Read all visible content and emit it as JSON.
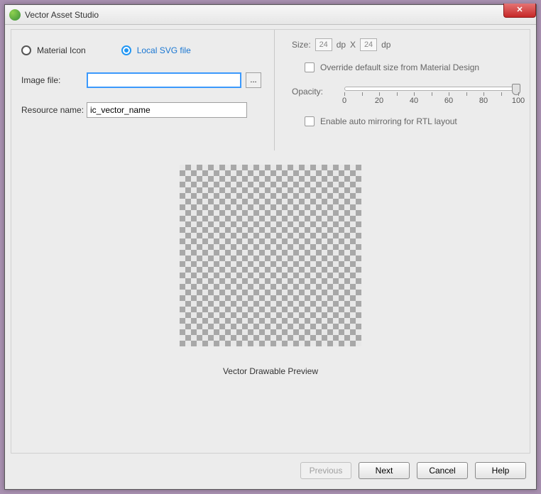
{
  "window": {
    "title": "Vector Asset Studio"
  },
  "source": {
    "material_label": "Material Icon",
    "svg_label": "Local SVG file",
    "selected": "svg"
  },
  "image_file": {
    "label": "Image file:",
    "value": "",
    "browse": "..."
  },
  "resource_name": {
    "label": "Resource name:",
    "value": "ic_vector_name"
  },
  "size": {
    "label": "Size:",
    "width": "24",
    "height": "24",
    "unit": "dp",
    "sep": "X"
  },
  "override": {
    "label": "Override default size from Material Design"
  },
  "opacity": {
    "label": "Opacity:",
    "value": 100,
    "ticks": [
      0,
      20,
      40,
      60,
      80,
      100
    ]
  },
  "rtl": {
    "label": "Enable auto mirroring for RTL layout"
  },
  "preview": {
    "caption": "Vector Drawable Preview"
  },
  "buttons": {
    "previous": "Previous",
    "next": "Next",
    "cancel": "Cancel",
    "help": "Help"
  }
}
